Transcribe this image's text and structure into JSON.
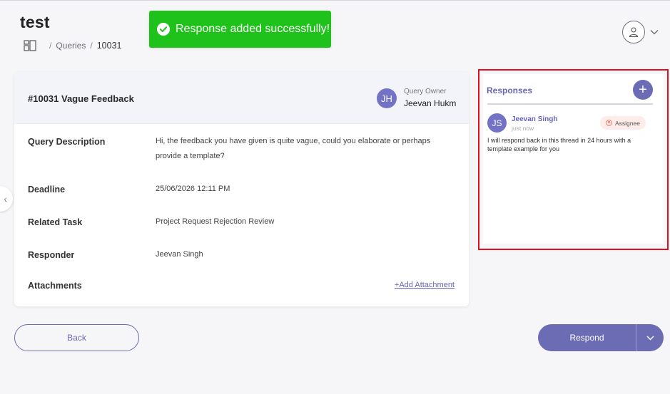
{
  "header": {
    "title": "test",
    "breadcrumb": {
      "items": [
        "Queries",
        "10031"
      ],
      "separator": "/"
    }
  },
  "toast": {
    "message": "Response added successfully!",
    "color": "#1fc21b"
  },
  "query": {
    "title": "#10031 Vague Feedback",
    "owner": {
      "initials": "JH",
      "label": "Query Owner",
      "name": "Jeevan Hukm"
    },
    "fields": {
      "description": {
        "label": "Query Description",
        "value": "Hi, the feedback you have given is quite vague, could you elaborate or perhaps provide a template?"
      },
      "deadline": {
        "label": "Deadline",
        "value": "25/06/2026 12:11 PM"
      },
      "related_task": {
        "label": "Related Task",
        "value": "Project Request Rejection Review"
      },
      "responder": {
        "label": "Responder",
        "value": "Jeevan Singh"
      },
      "attachments": {
        "label": "Attachments",
        "add_label": "+Add Attachment"
      }
    }
  },
  "actions": {
    "back_label": "Back",
    "respond_label": "Respond"
  },
  "responses": {
    "title": "Responses",
    "items": [
      {
        "initials": "JS",
        "name": "Jeevan Singh",
        "time": "just now",
        "badge": "Assignee",
        "message": "I will respond back in this thread in 24 hours with a template example for you"
      }
    ]
  },
  "colors": {
    "accent": "#6c6cb4",
    "highlight_border": "#e0101e"
  }
}
